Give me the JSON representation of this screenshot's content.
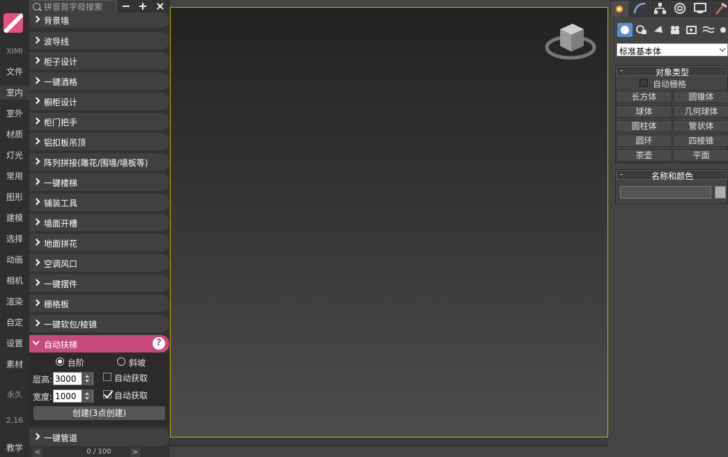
{
  "left_nav": {
    "brand": "XIMI",
    "items": [
      "文件",
      "室内",
      "室外",
      "材质",
      "灯光",
      "常用",
      "图形",
      "建模",
      "选择",
      "动画",
      "相机",
      "渲染",
      "自定",
      "设置",
      "素材"
    ],
    "license": "永久",
    "version": "2.16",
    "tutorial": "教学"
  },
  "plugin": {
    "search_placeholder": "拼音首字母搜索",
    "btn_minus": "−",
    "btn_plus": "+",
    "btn_close": "×",
    "menu_items": [
      "背景墙",
      "波导线",
      "柜子设计",
      "一键酒格",
      "橱柜设计",
      "柜门把手",
      "铝扣板吊顶",
      "阵列拼接(雕花/围墙/墙板等)",
      "一键楼梯",
      "铺装工具",
      "墙面开槽",
      "地面拼花",
      "空调风口",
      "一键摆件",
      "栅格板",
      "一键软包/棱镜"
    ],
    "expanded": {
      "title": "自动扶梯",
      "help": "?",
      "radio_step": "台阶",
      "radio_slope": "斜坡",
      "radio_selected": "台阶",
      "floor_height_label": "层高:",
      "floor_height_value": "3000",
      "auto_get_1": "自动获取",
      "auto_get_1_checked": false,
      "width_label": "宽度:",
      "width_value": "1000",
      "auto_get_2": "自动获取",
      "auto_get_2_checked": true,
      "create_button": "创建(3点创建)"
    },
    "last_item": "一键管道",
    "pager": {
      "prev": "<",
      "next": ">",
      "text": "0 / 100"
    }
  },
  "command_panel": {
    "tabs": [
      "create-icon",
      "modify-icon",
      "hierarchy-icon",
      "motion-icon",
      "display-icon",
      "utilities-icon"
    ],
    "subcategories": [
      "geometry-icon",
      "shapes-icon",
      "lights-icon",
      "cameras-icon",
      "helpers-icon",
      "spacewarps-icon",
      "systems-icon"
    ],
    "type_dropdown": "标准基本体",
    "object_type": {
      "title": "对象类型",
      "minus": "-",
      "autogrid_label": "自动栅格",
      "buttons": [
        "长方体",
        "圆锥体",
        "球体",
        "几何球体",
        "圆柱体",
        "管状体",
        "圆环",
        "四棱锥",
        "茶壶",
        "平面"
      ]
    },
    "name_color": {
      "title": "名称和颜色",
      "minus": "-",
      "name_value": ""
    }
  },
  "colors": {
    "accent": "#c94a78",
    "logo": "#e84f7f",
    "viewport_border": "#c8b400"
  }
}
